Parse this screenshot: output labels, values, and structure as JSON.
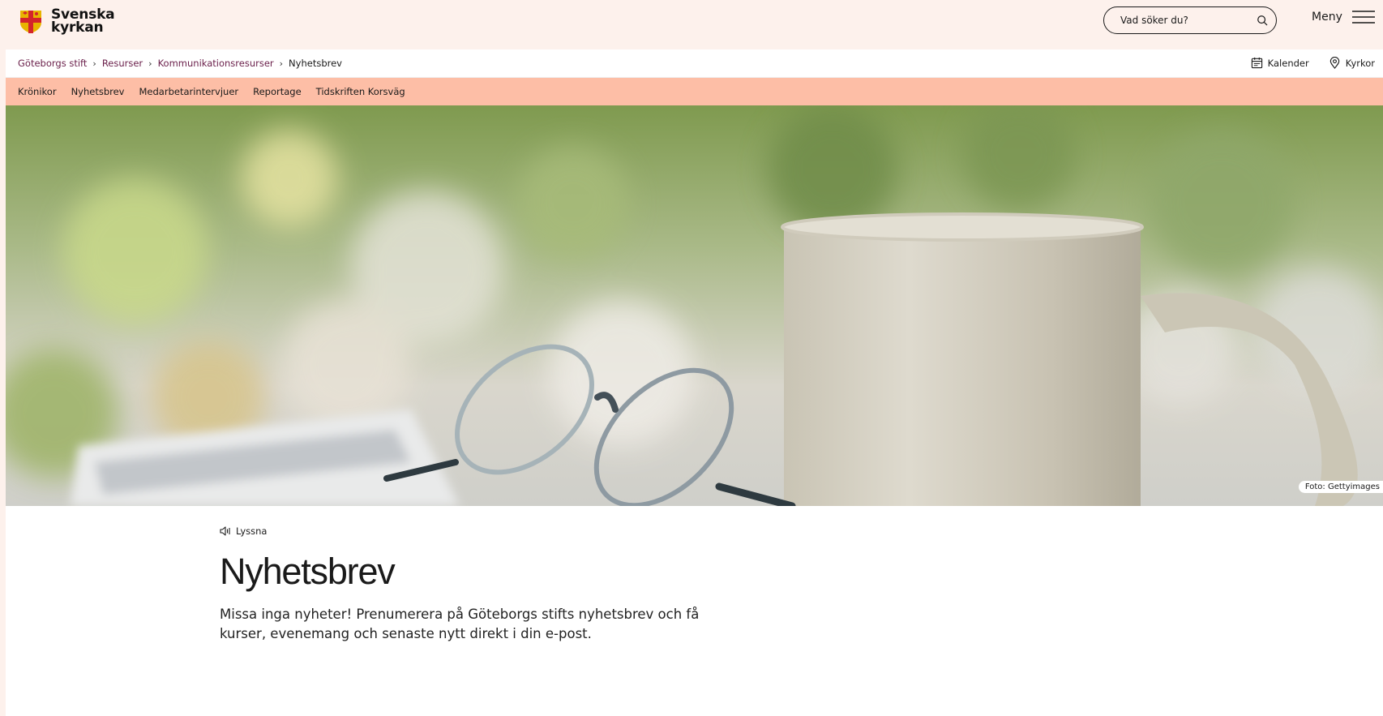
{
  "header": {
    "logo_line1": "Svenska",
    "logo_line2": "kyrkan",
    "search_placeholder": "Vad söker du?",
    "menu_label": "Meny"
  },
  "breadcrumb": {
    "items": [
      "Göteborgs stift",
      "Resurser",
      "Kommunikationsresurser"
    ],
    "separator": "›",
    "current": "Nyhetsbrev"
  },
  "quicklinks": {
    "calendar": "Kalender",
    "churches": "Kyrkor"
  },
  "subnav": {
    "items": [
      "Krönikor",
      "Nyhetsbrev",
      "Medarbetarintervjuer",
      "Reportage",
      "Tidskriften Korsväg"
    ]
  },
  "hero": {
    "photo_credit": "Foto: Gettyimages"
  },
  "article": {
    "listen_label": "Lyssna",
    "title": "Nyhetsbrev",
    "intro": "Missa inga nyheter! Prenumerera på Göteborgs stifts nyhetsbrev och få kurser, evenemang och senaste nytt direkt i din e-post."
  },
  "colors": {
    "page_background": "#fdf1ec",
    "subnav_background": "#fdbea6",
    "link_color": "#6a1f4a"
  },
  "icons": [
    "search-icon",
    "hamburger-icon",
    "calendar-icon",
    "location-pin-icon",
    "speaker-icon"
  ]
}
